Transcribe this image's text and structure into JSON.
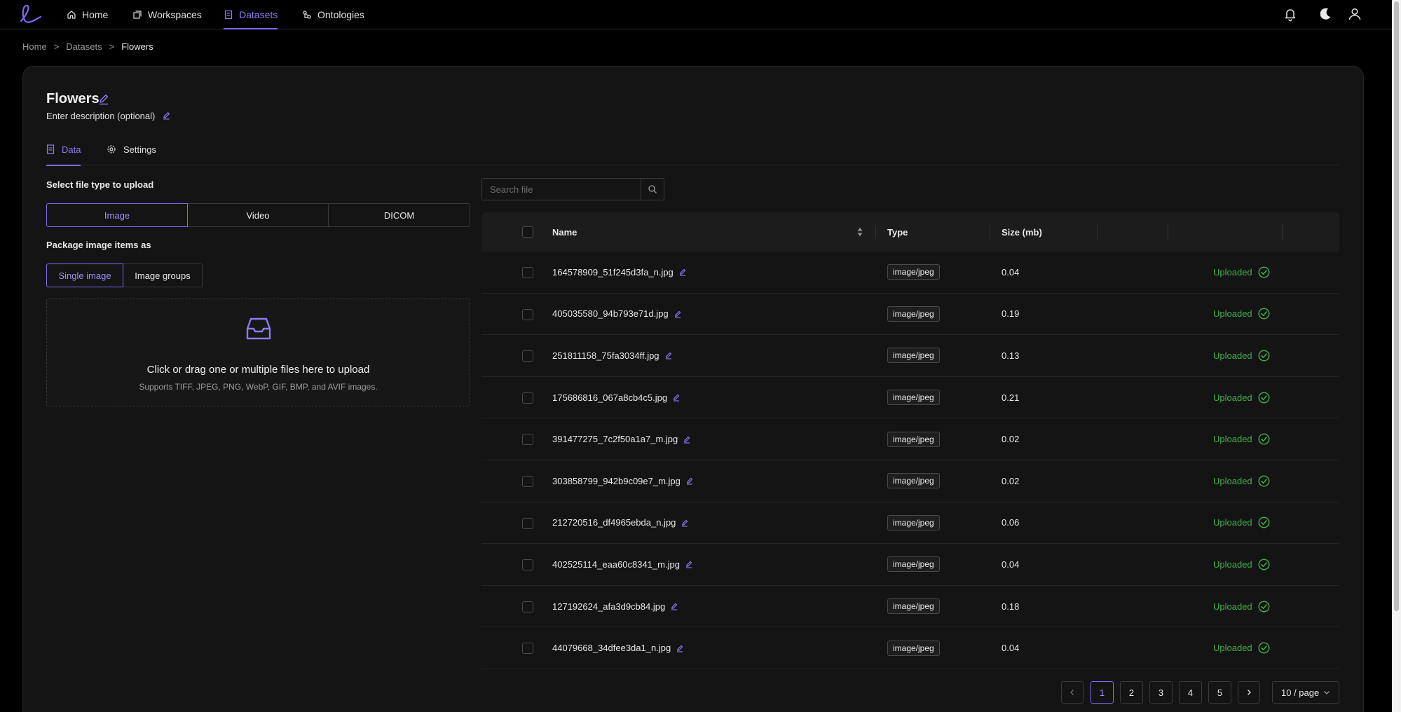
{
  "nav": {
    "items": [
      {
        "label": "Home",
        "icon": "home-icon"
      },
      {
        "label": "Workspaces",
        "icon": "workspaces-icon"
      },
      {
        "label": "Datasets",
        "icon": "datasets-icon",
        "active": true
      },
      {
        "label": "Ontologies",
        "icon": "ontologies-icon"
      }
    ],
    "right_icons": [
      "bell-icon",
      "moon-icon",
      "user-icon"
    ]
  },
  "breadcrumb": {
    "items": [
      "Home",
      "Datasets",
      "Flowers"
    ],
    "separator": ">"
  },
  "dataset": {
    "title": "Flowers",
    "description": "Enter description (optional)"
  },
  "tabs": [
    {
      "label": "Data",
      "active": true
    },
    {
      "label": "Settings"
    }
  ],
  "upload": {
    "file_type_label": "Select file type to upload",
    "file_types": [
      "Image",
      "Video",
      "DICOM"
    ],
    "selected_file_type": "Image",
    "package_label": "Package image items as",
    "package_options": [
      "Single image",
      "Image groups"
    ],
    "selected_package": "Single image",
    "dropzone_text": "Click or drag one or multiple files here to upload",
    "dropzone_hint": "Supports TIFF, JPEG, PNG, WebP, GIF, BMP, and AVIF images."
  },
  "search": {
    "placeholder": "Search file"
  },
  "table": {
    "columns": [
      "Name",
      "Type",
      "Size (mb)"
    ],
    "rows": [
      {
        "name": "164578909_51f245d3fa_n.jpg",
        "type": "image/jpeg",
        "size": "0.04",
        "status": "Uploaded"
      },
      {
        "name": "405035580_94b793e71d.jpg",
        "type": "image/jpeg",
        "size": "0.19",
        "status": "Uploaded"
      },
      {
        "name": "251811158_75fa3034ff.jpg",
        "type": "image/jpeg",
        "size": "0.13",
        "status": "Uploaded"
      },
      {
        "name": "175686816_067a8cb4c5.jpg",
        "type": "image/jpeg",
        "size": "0.21",
        "status": "Uploaded"
      },
      {
        "name": "391477275_7c2f50a1a7_m.jpg",
        "type": "image/jpeg",
        "size": "0.02",
        "status": "Uploaded"
      },
      {
        "name": "303858799_942b9c09e7_m.jpg",
        "type": "image/jpeg",
        "size": "0.02",
        "status": "Uploaded"
      },
      {
        "name": "212720516_df4965ebda_n.jpg",
        "type": "image/jpeg",
        "size": "0.06",
        "status": "Uploaded"
      },
      {
        "name": "402525114_eaa60c8341_m.jpg",
        "type": "image/jpeg",
        "size": "0.04",
        "status": "Uploaded"
      },
      {
        "name": "127192624_afa3d9cb84.jpg",
        "type": "image/jpeg",
        "size": "0.18",
        "status": "Uploaded"
      },
      {
        "name": "44079668_34dfee3da1_n.jpg",
        "type": "image/jpeg",
        "size": "0.04",
        "status": "Uploaded"
      }
    ]
  },
  "pagination": {
    "pages": [
      "1",
      "2",
      "3",
      "4",
      "5"
    ],
    "current": "1",
    "page_size": "10 / page"
  },
  "colors": {
    "accent": "#7c6cf0",
    "success": "#3db04a",
    "background": "#000000",
    "card": "#141414"
  }
}
